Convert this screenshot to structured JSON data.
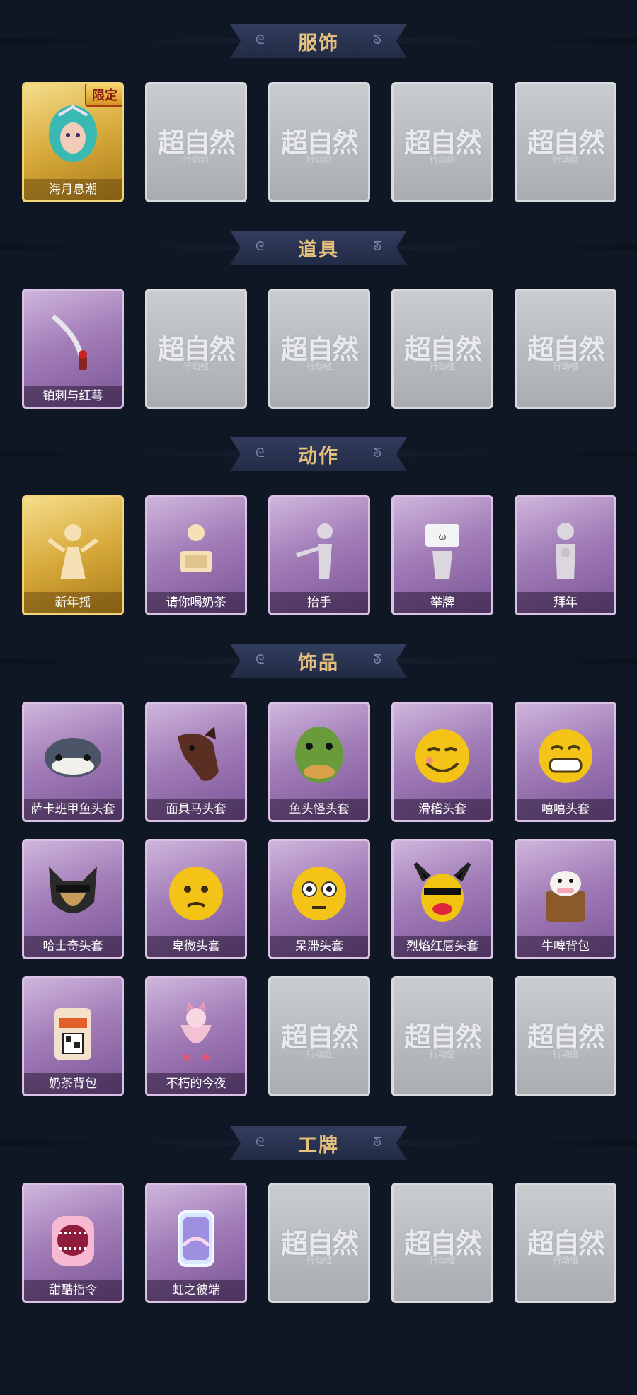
{
  "sections": [
    {
      "title": "服饰",
      "rows": [
        [
          {
            "state": "gold",
            "label": "海月息潮",
            "icon": "mermaid-icon",
            "badge": "限定"
          },
          {
            "state": "gray",
            "label": "",
            "icon": "placeholder-logo-icon"
          },
          {
            "state": "gray",
            "label": "",
            "icon": "placeholder-logo-icon"
          },
          {
            "state": "gray",
            "label": "",
            "icon": "placeholder-logo-icon"
          },
          {
            "state": "gray",
            "label": "",
            "icon": "placeholder-logo-icon"
          }
        ]
      ]
    },
    {
      "title": "道具",
      "rows": [
        [
          {
            "state": "purple",
            "label": "铂刺与红萼",
            "icon": "dagger-rose-icon"
          },
          {
            "state": "gray",
            "label": "",
            "icon": "placeholder-logo-icon"
          },
          {
            "state": "gray",
            "label": "",
            "icon": "placeholder-logo-icon"
          },
          {
            "state": "gray",
            "label": "",
            "icon": "placeholder-logo-icon"
          },
          {
            "state": "gray",
            "label": "",
            "icon": "placeholder-logo-icon"
          }
        ]
      ]
    },
    {
      "title": "动作",
      "rows": [
        [
          {
            "state": "gold",
            "label": "新年摇",
            "icon": "dance-icon"
          },
          {
            "state": "purple",
            "label": "请你喝奶茶",
            "icon": "milk-tea-gesture-icon"
          },
          {
            "state": "purple",
            "label": "抬手",
            "icon": "raise-hand-icon"
          },
          {
            "state": "purple",
            "label": "举牌",
            "icon": "hold-sign-icon"
          },
          {
            "state": "purple",
            "label": "拜年",
            "icon": "new-year-greeting-icon"
          }
        ]
      ]
    },
    {
      "title": "饰品",
      "rows": [
        [
          {
            "state": "purple",
            "label": "萨卡班甲鱼头套",
            "icon": "fish-head-icon"
          },
          {
            "state": "purple",
            "label": "面具马头套",
            "icon": "horse-head-icon"
          },
          {
            "state": "purple",
            "label": "鱼头怪头套",
            "icon": "green-fish-head-icon"
          },
          {
            "state": "purple",
            "label": "滑稽头套",
            "icon": "funny-face-icon"
          },
          {
            "state": "purple",
            "label": "嘻嘻头套",
            "icon": "grin-face-icon"
          }
        ],
        [
          {
            "state": "purple",
            "label": "哈士奇头套",
            "icon": "husky-head-icon"
          },
          {
            "state": "purple",
            "label": "卑微头套",
            "icon": "humble-face-icon"
          },
          {
            "state": "purple",
            "label": "呆滞头套",
            "icon": "stare-face-icon"
          },
          {
            "state": "purple",
            "label": "烈焰红唇头套",
            "icon": "pikachu-lips-icon"
          },
          {
            "state": "purple",
            "label": "牛啤背包",
            "icon": "cow-beer-backpack-icon"
          }
        ],
        [
          {
            "state": "purple",
            "label": "奶茶背包",
            "icon": "milk-tea-backpack-icon"
          },
          {
            "state": "purple",
            "label": "不朽的今夜",
            "icon": "cat-cup-icon"
          },
          {
            "state": "gray",
            "label": "",
            "icon": "placeholder-logo-icon"
          },
          {
            "state": "gray",
            "label": "",
            "icon": "placeholder-logo-icon"
          },
          {
            "state": "gray",
            "label": "",
            "icon": "placeholder-logo-icon"
          }
        ]
      ]
    },
    {
      "title": "工牌",
      "rows": [
        [
          {
            "state": "purple",
            "label": "甜酷指令",
            "icon": "shark-badge-icon"
          },
          {
            "state": "purple",
            "label": "虹之彼端",
            "icon": "rainbow-badge-icon"
          },
          {
            "state": "gray",
            "label": "",
            "icon": "placeholder-logo-icon"
          },
          {
            "state": "gray",
            "label": "",
            "icon": "placeholder-logo-icon"
          },
          {
            "state": "gray",
            "label": "",
            "icon": "placeholder-logo-icon"
          }
        ]
      ]
    }
  ],
  "placeholder_logo": {
    "main": "超自然",
    "sub": "行动组"
  },
  "colors": {
    "background": "#0f1725",
    "title": "#e6c17e",
    "gold": "#d7aa3b",
    "purple": "#a27db8",
    "gray": "#b9bcc0"
  }
}
